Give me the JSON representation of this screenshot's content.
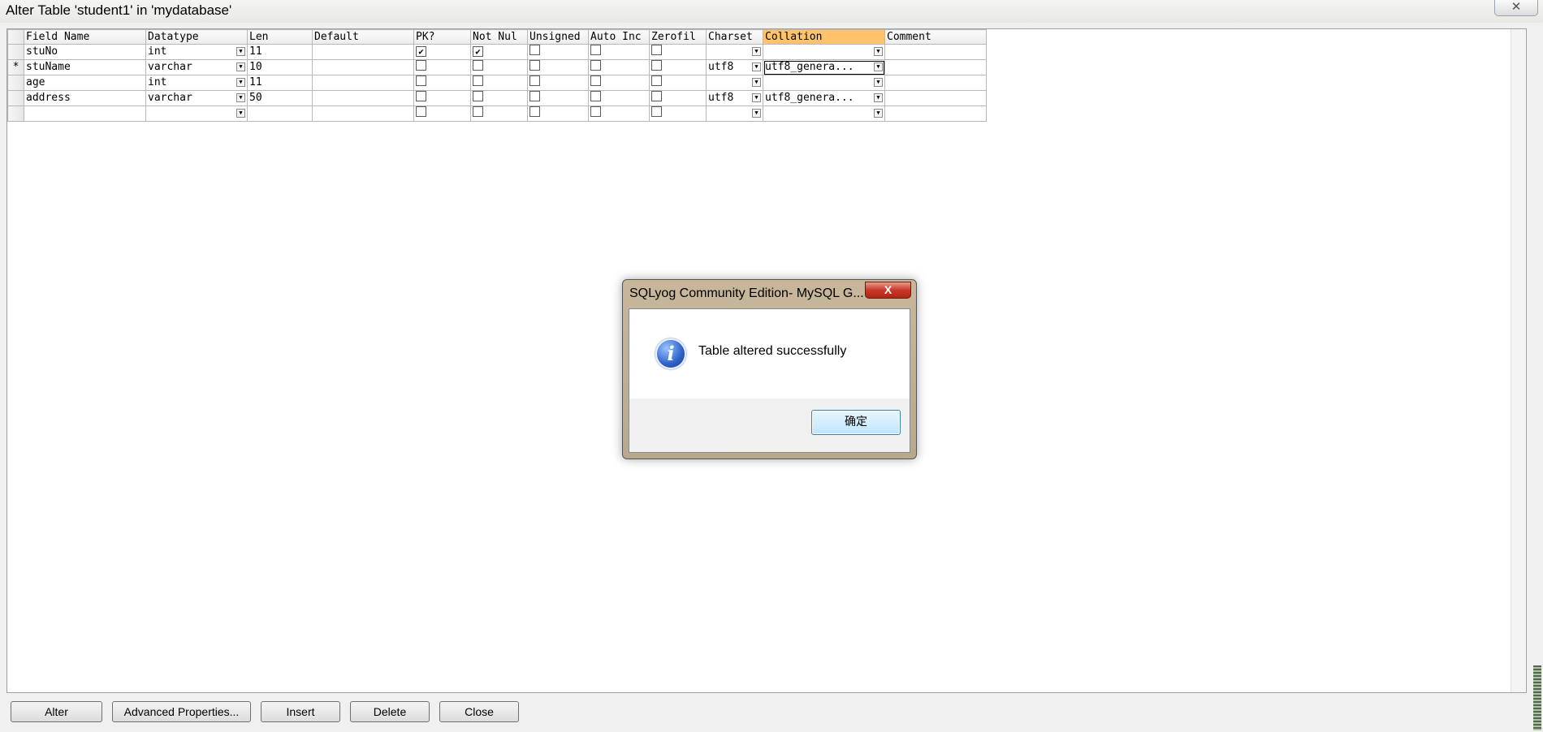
{
  "window": {
    "title": "Alter Table 'student1' in 'mydatabase'",
    "close_glyph": "✕"
  },
  "grid": {
    "columns": [
      "Field Name",
      "Datatype",
      "Len",
      "Default",
      "PK?",
      "Not Nul",
      "Unsigned",
      "Auto Inc",
      "Zerofil",
      "Charset",
      "Collation",
      "Comment"
    ],
    "highlighted_column": "Collation",
    "rows": [
      {
        "marker": "",
        "field": "stuNo",
        "datatype": "int",
        "len": "11",
        "default": "",
        "pk": true,
        "notnull": true,
        "unsigned": false,
        "autoinc": false,
        "zerofill": false,
        "charset": "",
        "collation": "",
        "comment": ""
      },
      {
        "marker": "*",
        "field": "stuName",
        "datatype": "varchar",
        "len": "10",
        "default": "",
        "pk": false,
        "notnull": false,
        "unsigned": false,
        "autoinc": false,
        "zerofill": false,
        "charset": "utf8",
        "collation": "utf8_genera...",
        "comment": ""
      },
      {
        "marker": "",
        "field": "age",
        "datatype": "int",
        "len": "11",
        "default": "",
        "pk": false,
        "notnull": false,
        "unsigned": false,
        "autoinc": false,
        "zerofill": false,
        "charset": "",
        "collation": "",
        "comment": ""
      },
      {
        "marker": "",
        "field": "address",
        "datatype": "varchar",
        "len": "50",
        "default": "",
        "pk": false,
        "notnull": false,
        "unsigned": false,
        "autoinc": false,
        "zerofill": false,
        "charset": "utf8",
        "collation": "utf8_genera...",
        "comment": ""
      },
      {
        "marker": "",
        "field": "",
        "datatype": "",
        "len": "",
        "default": "",
        "pk": false,
        "notnull": false,
        "unsigned": false,
        "autoinc": false,
        "zerofill": false,
        "charset": "",
        "collation": "",
        "comment": ""
      }
    ]
  },
  "buttons": {
    "alter": "Alter",
    "advanced": "Advanced Properties...",
    "insert": "Insert",
    "delete": "Delete",
    "close": "Close"
  },
  "dialog": {
    "title": "SQLyog Community Edition- MySQL G...",
    "close_glyph": "X",
    "icon_glyph": "i",
    "message": "Table altered successfully",
    "ok_label": "确定"
  },
  "colors": {
    "highlight_header": "#ffc46b",
    "dialog_close": "#c7382a"
  }
}
